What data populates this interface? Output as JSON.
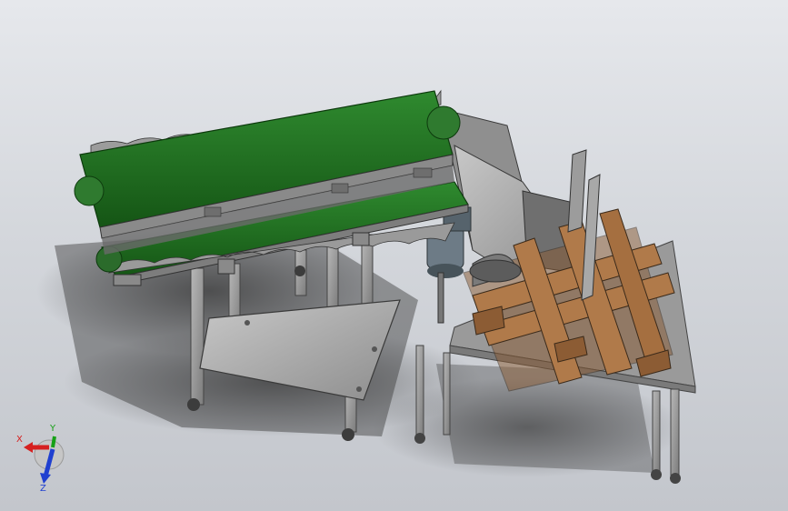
{
  "viewport": {
    "background_top": "#e6e8ec",
    "background_bottom": "#c3c6cc"
  },
  "model": {
    "conveyor_belt_color": "#1f6b1f",
    "frame_color": "#9a9a9a",
    "pallet_color": "#b07a4a",
    "table_color": "#a9a9a9",
    "motor_color": "#6d7b86"
  },
  "triad": {
    "x_label": "X",
    "y_label": "Y",
    "z_label": "Z",
    "x_color": "#d62020",
    "y_color": "#16a016",
    "z_color": "#2040d0"
  }
}
